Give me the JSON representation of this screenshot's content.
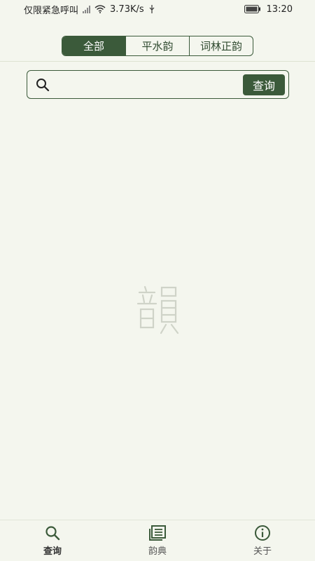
{
  "status_bar": {
    "carrier_text": "仅限紧急呼叫",
    "network_speed": "3.73K/s",
    "time": "13:20"
  },
  "tabs": [
    {
      "label": "全部",
      "active": true
    },
    {
      "label": "平水韵",
      "active": false
    },
    {
      "label": "词林正韵",
      "active": false
    }
  ],
  "search": {
    "placeholder": "",
    "value": "",
    "button_label": "查询",
    "icon": "search-icon"
  },
  "watermark": {
    "character": "韻",
    "color": "#cfd3c8"
  },
  "bottom_nav": [
    {
      "label": "查询",
      "icon": "search-icon",
      "active": true
    },
    {
      "label": "韵典",
      "icon": "book-icon",
      "active": false
    },
    {
      "label": "关于",
      "icon": "info-icon",
      "active": false
    }
  ],
  "colors": {
    "accent": "#3b5a3a",
    "background": "#f4f6ee"
  }
}
